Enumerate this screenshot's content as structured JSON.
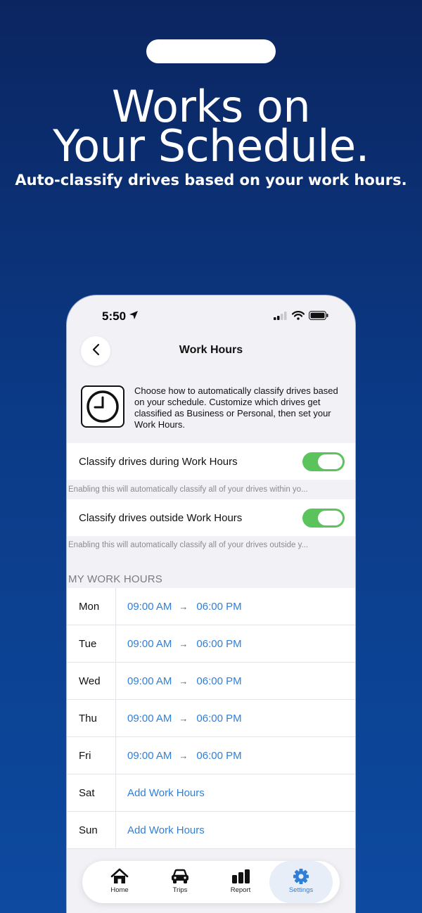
{
  "promo": {
    "headline_line1": "Works on",
    "headline_line2": "Your Schedule.",
    "subheadline": "Auto-classify drives based on your work hours."
  },
  "status_bar": {
    "time": "5:50"
  },
  "nav": {
    "title": "Work Hours"
  },
  "intro": {
    "icon": "clock-icon",
    "description": "Choose how to automatically classify drives based on your schedule. Customize which drives get classified as Business or Personal, then set your Work Hours."
  },
  "settings": [
    {
      "label": "Classify drives during Work Hours",
      "enabled": true,
      "hint": "Enabling this will automatically classify all of your drives within yo..."
    },
    {
      "label": "Classify drives outside Work Hours",
      "enabled": true,
      "hint": "Enabling this will automatically classify all of your drives outside y..."
    }
  ],
  "work_hours": {
    "section_title": "MY WORK HOURS",
    "days": [
      {
        "day": "Mon",
        "start": "09:00 AM",
        "end": "06:00 PM"
      },
      {
        "day": "Tue",
        "start": "09:00 AM",
        "end": "06:00 PM"
      },
      {
        "day": "Wed",
        "start": "09:00 AM",
        "end": "06:00 PM"
      },
      {
        "day": "Thu",
        "start": "09:00 AM",
        "end": "06:00 PM"
      },
      {
        "day": "Fri",
        "start": "09:00 AM",
        "end": "06:00 PM"
      },
      {
        "day": "Sat",
        "add_label": "Add Work Hours"
      },
      {
        "day": "Sun",
        "add_label": "Add Work Hours"
      }
    ]
  },
  "tabs": [
    {
      "label": "Home",
      "icon": "home-icon"
    },
    {
      "label": "Trips",
      "icon": "car-icon"
    },
    {
      "label": "Report",
      "icon": "bar-chart-icon"
    },
    {
      "label": "Settings",
      "icon": "gear-icon",
      "active": true
    }
  ],
  "colors": {
    "accent": "#2f7fd8",
    "toggle_on": "#5ac35c",
    "background_top": "#0b2560",
    "background_bottom": "#0d4aa0"
  }
}
